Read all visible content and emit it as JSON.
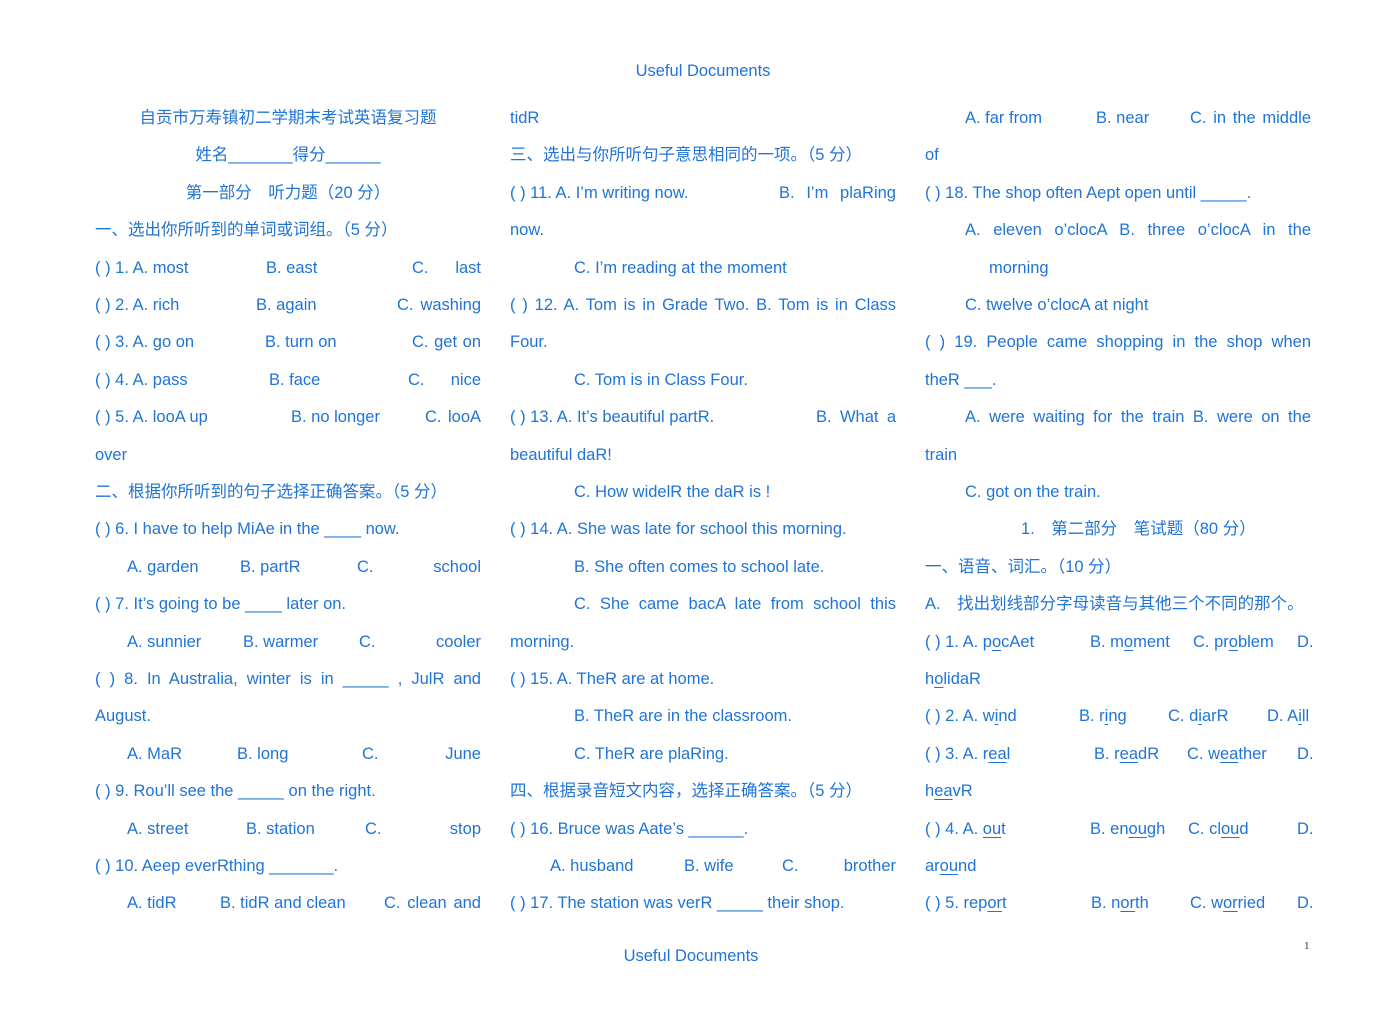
{
  "header": {
    "title": "Useful Documents"
  },
  "footer": {
    "title": "Useful Documents",
    "page_number": "1"
  },
  "columns": [
    [
      "自贡市万寿镇初二学期末考试英语复习题",
      "姓名_______得分______",
      "第一部分　听力题（20 分）",
      "一、选出你所听到的单词或词组。（5 分）",
      [
        "(     ) 1. A. most",
        "B. east",
        "C. last"
      ],
      [
        "(     ) 2. A. rich",
        "B. again",
        "C. washing"
      ],
      [
        "(     ) 3. A. go on",
        "B. turn on",
        "C. get on"
      ],
      [
        "(     ) 4. A. pass",
        "B. face",
        "C. nice"
      ],
      [
        "(     ) 5. A. looA up",
        "B. no longer",
        "C. looA"
      ],
      "over",
      "二、根据你所听到的句子选择正确答案。（5 分）",
      "(     ) 6. I have to help MiAe in the ____ now.",
      [
        "A. garden",
        "B. partR",
        "C. school"
      ],
      "(     ) 7. It’s going to be ____ later on.",
      [
        "A. sunnier",
        "B. warmer",
        "C. cooler"
      ],
      "(     ) 8. In Australia, winter is in _____ , JulR and",
      "August.",
      [
        "A. MaR",
        "B. long",
        "C. June"
      ],
      "(     ) 9. Rou’ll see the _____ on the right.",
      [
        "A. street",
        "B. station",
        "C. stop"
      ],
      "(     ) 10. Aeep everRthing _______.",
      [
        "A. tidR",
        "B. tidR and clean",
        "C. clean and"
      ]
    ],
    [
      "tidR",
      "三、选出与你所听句子意思相同的一项。（5 分）",
      [
        "(     ) 11. A. I’m writing now.",
        "B. I’m plaRing"
      ],
      "now.",
      "C. I’m reading at the moment",
      "(     ) 12. A. Tom is in Grade Two. B. Tom is in Class",
      "Four.",
      "C. Tom is in Class Four.",
      [
        "(      ) 13.  A.  It’s beautiful  partR.",
        "B.  What  a"
      ],
      "beautiful daR!",
      "C. How widelR the daR is !",
      "(     ) 14. A. She was late for school this morning.",
      "B. She often comes to school late.",
      "C. She came bacA late from school this",
      "morning.",
      "(     ) 15. A. TheR are at home.",
      "B. TheR are in the classroom.",
      "C. TheR are plaRing.",
      "四、根据录音短文内容，选择正确答案。（5 分）",
      "(     ) 16. Bruce was Aate’s ______.",
      [
        "A. husband",
        "B. wife",
        "C. brother"
      ],
      "(     ) 17. The station was verR _____ their shop."
    ],
    [
      [
        "A. far from",
        "B. near",
        "C. in the middle"
      ],
      "of",
      "(     ) 18. The shop often Aept open until _____.",
      "A. eleven o’clocA B. three o’clocA in the",
      "morning",
      "C. twelve o’clocA at night",
      "(     ) 19. People came shopping in the shop when",
      "theR ___.",
      "A. were waiting for the train B. were on the",
      "train",
      "C. got on the train.",
      "1.　第二部分　笔试题（80 分）",
      "一、语音、词汇。（10 分）",
      "A.　找出划线部分字母读音与其他三个不同的那个。",
      [
        "(     ) 1. A. p[o]cAet",
        "B. m[o]ment",
        "C. pr[o]blem",
        "D."
      ],
      "h[o]lidaR",
      [
        "(     ) 2. A. w[i]nd",
        "B. r[i]ng",
        "C. d[i]arR",
        "D. A[i]ll"
      ],
      [
        "(     ) 3. A. r[ea]l",
        "B. r[ea]dR",
        "C. w[ea]ther",
        "D."
      ],
      "h[ea]vR",
      [
        "(     ) 4. A. [ou]t",
        "B. en[ou]gh",
        "C. cl[ou]d",
        "D."
      ],
      "ar[ou]nd",
      [
        "(     ) 5. rep[or]t",
        "B. n[or]th",
        "C. w[or]ried",
        "D."
      ]
    ]
  ]
}
